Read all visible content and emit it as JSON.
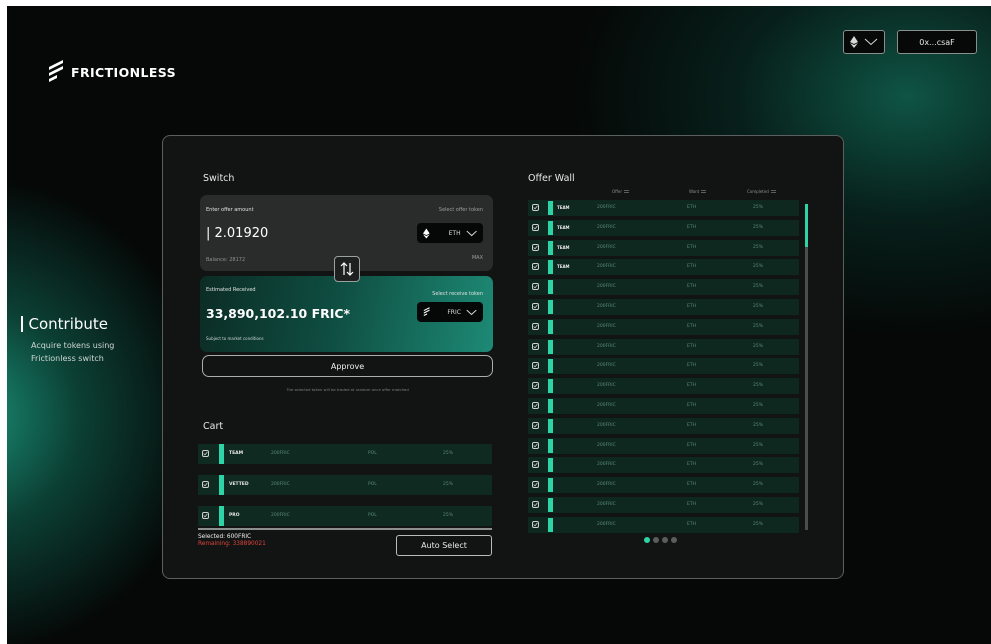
{
  "header": {
    "brand": "FRICTIONLESS",
    "wallet_label": "0x...csaF"
  },
  "sidebar": {
    "title": "Contribute",
    "description": "Acquire tokens using Frictionless switch"
  },
  "switch": {
    "title": "Switch",
    "offer": {
      "label": "Enter offer amount",
      "select_label": "Select offer token",
      "amount": "| 2.01920",
      "token": "ETH",
      "balance": "Balance: 28172",
      "max": "MAX"
    },
    "receive": {
      "label": "Estimated Received",
      "select_label": "Select receive token",
      "amount": "33,890,102.10 FRIC*",
      "token": "FRIC",
      "sub": "Subject to market conditions"
    },
    "approve_label": "Approve",
    "note": "The selected token will be traded at random once offer matched"
  },
  "cart": {
    "title": "Cart",
    "rows": [
      {
        "tag": "TEAM",
        "offer": "200FRIC",
        "want": "POL",
        "completed": "25%"
      },
      {
        "tag": "VETTED",
        "offer": "200FRIC",
        "want": "POL",
        "completed": "25%"
      },
      {
        "tag": "PRO",
        "offer": "200FRIC",
        "want": "POL",
        "completed": "25%"
      }
    ],
    "selected": "Selected: 600FRIC",
    "remaining": "Remaining: 338890021",
    "auto_select_label": "Auto Select"
  },
  "offer_wall": {
    "title": "Offer Wall",
    "columns": [
      "Offer",
      "Want",
      "Completed"
    ],
    "rows": [
      {
        "tag": "TEAM",
        "offer": "200FRIC",
        "want": "ETH",
        "completed": "25%"
      },
      {
        "tag": "TEAM",
        "offer": "200FRIC",
        "want": "ETH",
        "completed": "25%"
      },
      {
        "tag": "TEAM",
        "offer": "200FRIC",
        "want": "ETH",
        "completed": "25%"
      },
      {
        "tag": "TEAM",
        "offer": "200FRIC",
        "want": "ETH",
        "completed": "25%"
      },
      {
        "tag": "",
        "offer": "200FRIC",
        "want": "ETH",
        "completed": "25%"
      },
      {
        "tag": "",
        "offer": "200FRIC",
        "want": "ETH",
        "completed": "25%"
      },
      {
        "tag": "",
        "offer": "200FRIC",
        "want": "ETH",
        "completed": "25%"
      },
      {
        "tag": "",
        "offer": "200FRIC",
        "want": "ETH",
        "completed": "25%"
      },
      {
        "tag": "",
        "offer": "200FRIC",
        "want": "ETH",
        "completed": "25%"
      },
      {
        "tag": "",
        "offer": "200FRIC",
        "want": "ETH",
        "completed": "25%"
      },
      {
        "tag": "",
        "offer": "200FRIC",
        "want": "ETH",
        "completed": "25%"
      },
      {
        "tag": "",
        "offer": "200FRIC",
        "want": "ETH",
        "completed": "25%"
      },
      {
        "tag": "",
        "offer": "200FRIC",
        "want": "ETH",
        "completed": "25%"
      },
      {
        "tag": "",
        "offer": "200FRIC",
        "want": "ETH",
        "completed": "25%"
      },
      {
        "tag": "",
        "offer": "200FRIC",
        "want": "ETH",
        "completed": "25%"
      },
      {
        "tag": "",
        "offer": "200FRIC",
        "want": "ETH",
        "completed": "25%"
      },
      {
        "tag": "",
        "offer": "200FRIC",
        "want": "ETH",
        "completed": "25%"
      }
    ],
    "page_count": 4,
    "active_page": 1
  },
  "colors": {
    "accent": "#2ed3a6",
    "danger": "#e0463f"
  },
  "icons": [
    "logo-mark-icon",
    "ethereum-icon",
    "chevron-down-icon",
    "swap-arrows-icon",
    "checkbox-icon",
    "fric-icon",
    "sort-icon"
  ]
}
